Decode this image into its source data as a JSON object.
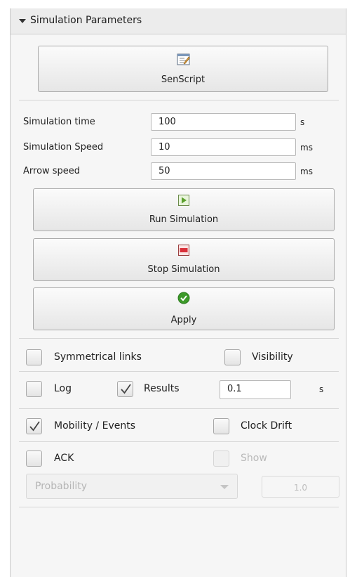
{
  "panel": {
    "title": "Simulation Parameters"
  },
  "buttons": {
    "senscript": "SenScript",
    "run": "Run Simulation",
    "stop": "Stop Simulation",
    "apply": "Apply"
  },
  "params": [
    {
      "label": "Simulation time",
      "value": "100",
      "unit": "s"
    },
    {
      "label": "Simulation Speed",
      "value": "10",
      "unit": "ms"
    },
    {
      "label": "Arrow speed",
      "value": "50",
      "unit": "ms"
    }
  ],
  "options": {
    "symmetrical_links": {
      "label": "Symmetrical links",
      "checked": false
    },
    "visibility": {
      "label": "Visibility",
      "checked": false
    },
    "log": {
      "label": "Log",
      "checked": false
    },
    "results": {
      "label": "Results",
      "checked": true,
      "value": "0.1",
      "unit": "s"
    },
    "mobility_events": {
      "label": "Mobility / Events",
      "checked": true
    },
    "clock_drift": {
      "label": "Clock Drift",
      "checked": false
    },
    "ack": {
      "label": "ACK",
      "checked": false
    },
    "show": {
      "label": "Show",
      "checked": false,
      "disabled": true
    }
  },
  "ack_config": {
    "mode": "Probability",
    "value": "1.0"
  },
  "colors": {
    "run_icon": "#5aa02c",
    "stop_icon": "#d9303a",
    "apply_icon": "#3d9a2a"
  }
}
